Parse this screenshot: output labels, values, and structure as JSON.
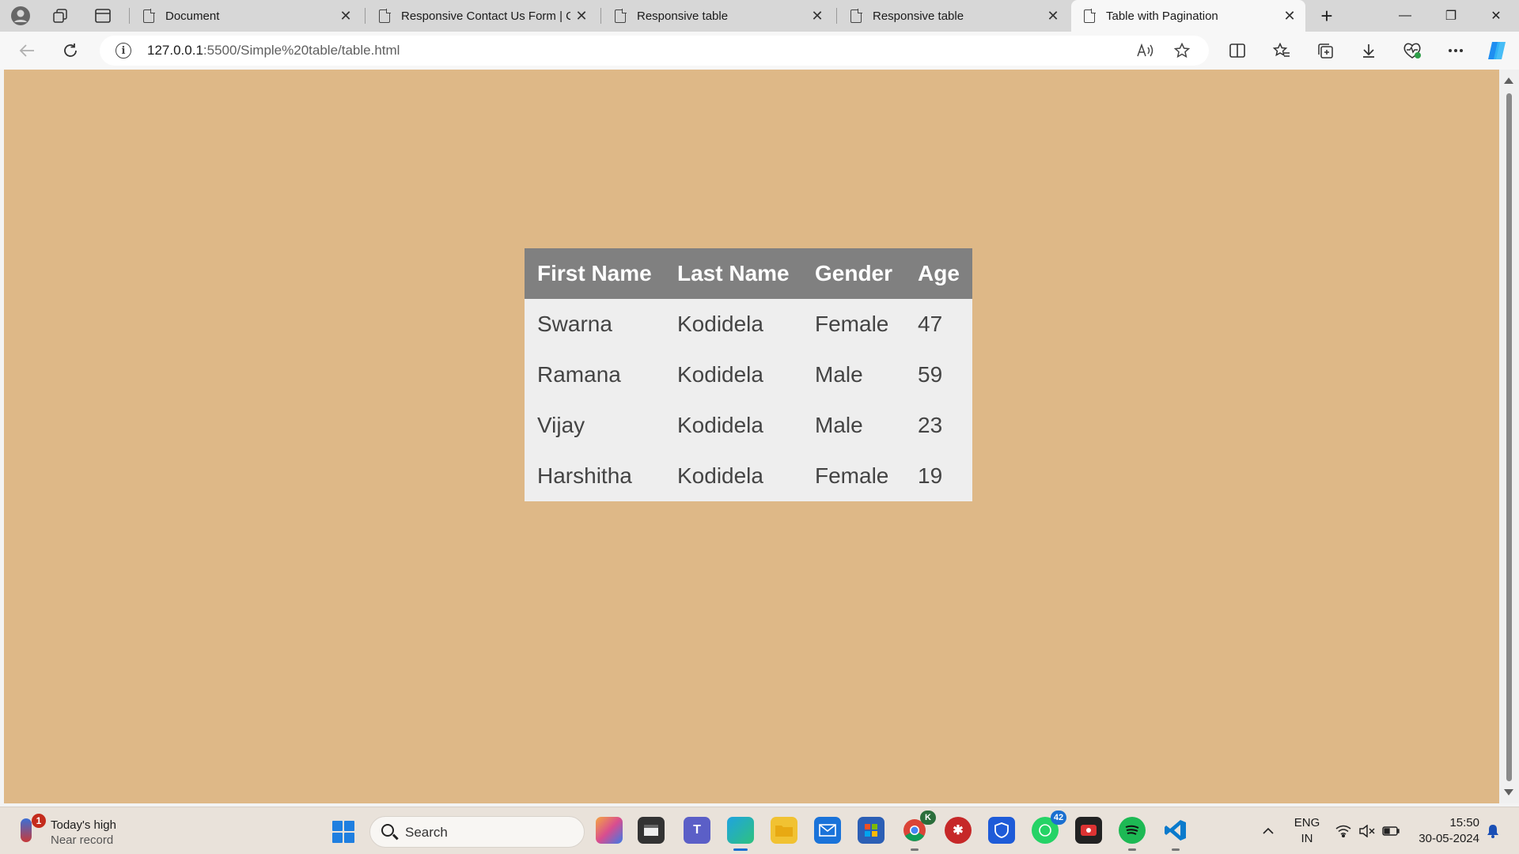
{
  "browser": {
    "tabs": [
      {
        "title": "Document",
        "active": false
      },
      {
        "title": "Responsive Contact Us Form | Co",
        "active": false
      },
      {
        "title": "Responsive table",
        "active": false
      },
      {
        "title": "Responsive table",
        "active": false
      },
      {
        "title": "Table with Pagination",
        "active": true
      }
    ],
    "new_tab": "+",
    "window_controls": {
      "minimize": "—",
      "restore": "❐",
      "close": "✕"
    },
    "address": {
      "host": "127.0.0.1",
      "path": ":5500/Simple%20table/table.html"
    },
    "icons": [
      "back-icon",
      "refresh-icon",
      "site-info-icon",
      "read-aloud-icon",
      "favorite-star-icon",
      "split-screen-icon",
      "favorites-icon",
      "collections-icon",
      "downloads-icon",
      "browser-essentials-icon",
      "more-icon",
      "copilot-icon"
    ]
  },
  "page": {
    "background": "#deb887",
    "table": {
      "columns": [
        "First Name",
        "Last Name",
        "Gender",
        "Age"
      ],
      "rows": [
        [
          "Swarna",
          "Kodidela",
          "Female",
          "47"
        ],
        [
          "Ramana",
          "Kodidela",
          "Male",
          "59"
        ],
        [
          "Vijay",
          "Kodidela",
          "Male",
          "23"
        ],
        [
          "Harshitha",
          "Kodidela",
          "Female",
          "19"
        ]
      ],
      "header_bg": "#808080",
      "body_bg": "#eeeeee"
    }
  },
  "taskbar": {
    "weather": {
      "badge": "1",
      "line1": "Today's high",
      "line2": "Near record"
    },
    "search_label": "Search",
    "whatsapp_badge": "42",
    "chrome_badge": "K",
    "lang": {
      "line1": "ENG",
      "line2": "IN"
    },
    "clock": {
      "time": "15:50",
      "date": "30-05-2024"
    }
  }
}
